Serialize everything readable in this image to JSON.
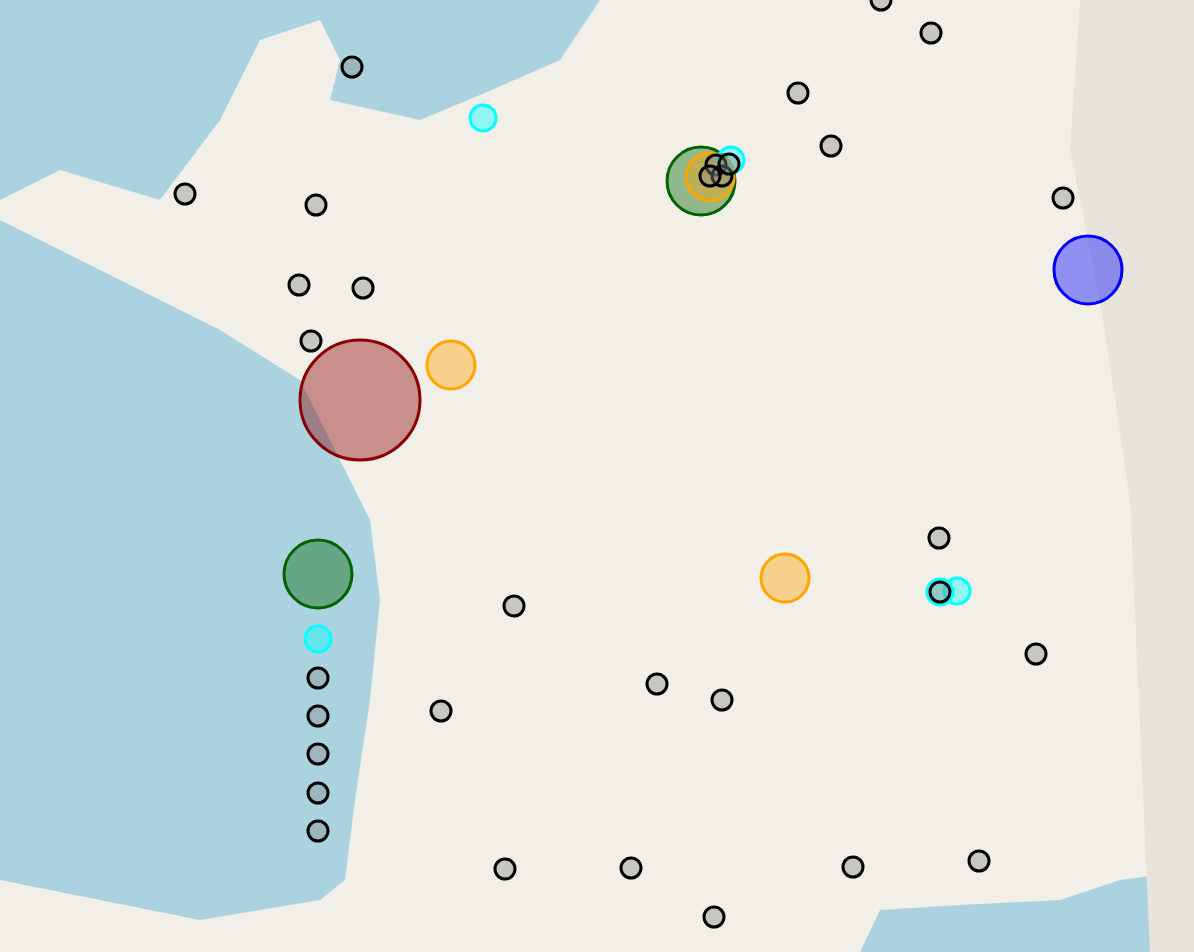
{
  "map": {
    "markers": [
      {
        "kind": "small",
        "color": "#000000"
      },
      {
        "kind": "small",
        "color": "#000000"
      },
      {
        "kind": "small",
        "color": "#000000"
      },
      {
        "kind": "small",
        "color": "#000000"
      },
      {
        "kind": "small",
        "color": "#000000"
      },
      {
        "kind": "small",
        "color": "#000000"
      },
      {
        "kind": "small",
        "color": "#000000"
      },
      {
        "kind": "small",
        "color": "#000000"
      },
      {
        "kind": "small",
        "color": "#000000"
      },
      {
        "kind": "small",
        "color": "#000000"
      },
      {
        "kind": "small",
        "color": "#000000"
      },
      {
        "kind": "small",
        "color": "#000000"
      },
      {
        "kind": "small",
        "color": "#000000"
      },
      {
        "kind": "small",
        "color": "#000000"
      },
      {
        "kind": "small",
        "color": "#000000"
      },
      {
        "kind": "small",
        "color": "#000000"
      },
      {
        "kind": "small",
        "color": "#000000"
      },
      {
        "kind": "small",
        "color": "#000000"
      },
      {
        "kind": "small",
        "color": "#000000"
      },
      {
        "kind": "small",
        "color": "#000000"
      },
      {
        "kind": "small",
        "color": "#000000"
      },
      {
        "kind": "small",
        "color": "#000000"
      },
      {
        "kind": "small",
        "color": "#000000"
      },
      {
        "kind": "small",
        "color": "#000000"
      },
      {
        "kind": "small",
        "color": "#000000"
      },
      {
        "kind": "small",
        "color": "#000000"
      },
      {
        "kind": "small",
        "color": "#000000"
      },
      {
        "kind": "medium",
        "color": "#00ffff"
      },
      {
        "kind": "medium",
        "color": "#00ffff"
      },
      {
        "kind": "medium",
        "color": "#00ffff"
      },
      {
        "kind": "medium",
        "color": "#00ffff"
      },
      {
        "kind": "medium",
        "color": "#00ffff"
      },
      {
        "kind": "small",
        "color": "#000000"
      },
      {
        "kind": "large",
        "color": "#ffa500"
      },
      {
        "kind": "large",
        "color": "#ffa500"
      },
      {
        "kind": "large",
        "color": "#ffa500"
      },
      {
        "kind": "x-large",
        "color": "#006400"
      },
      {
        "kind": "x-large",
        "color": "#006400"
      },
      {
        "kind": "xx-large",
        "color": "#8b0000"
      },
      {
        "kind": "x-large",
        "color": "#0000ff"
      },
      {
        "kind": "small",
        "color": "#000000"
      },
      {
        "kind": "small",
        "color": "#000000"
      },
      {
        "kind": "small",
        "color": "#000000"
      },
      {
        "kind": "small",
        "color": "#000000"
      }
    ]
  }
}
